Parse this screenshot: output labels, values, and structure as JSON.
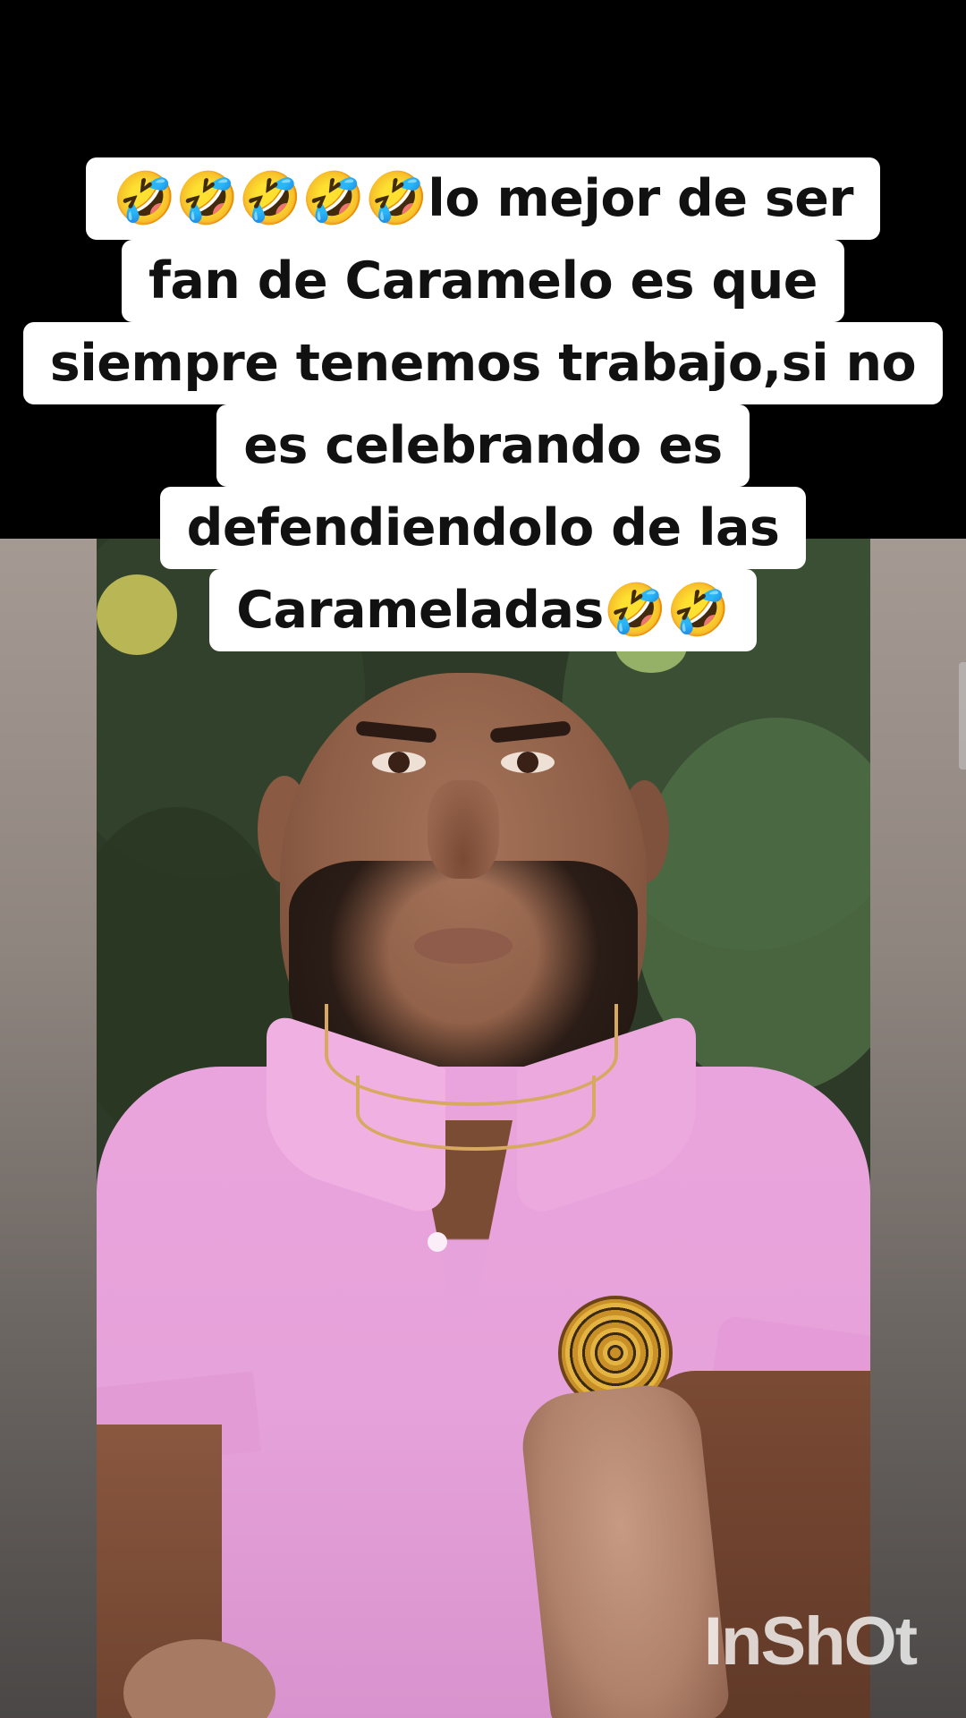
{
  "caption": {
    "lines": [
      "🤣🤣🤣🤣🤣lo mejor de ser",
      "fan de Caramelo es que",
      "siempre tenemos trabajo,si no",
      "es celebrando es",
      "defendiendolo de las",
      "Carameladas🤣🤣"
    ]
  },
  "watermark": {
    "text": "InShOt"
  },
  "colors": {
    "caption_bg": "#ffffff",
    "caption_text": "#111111",
    "shirt": "#e6a2da",
    "top_band": "#000000"
  }
}
